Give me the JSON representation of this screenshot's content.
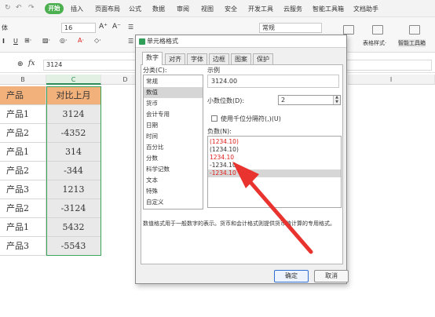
{
  "menubar": {
    "quick_access": [
      "ን",
      "↶",
      "↷"
    ],
    "start_label": "开始",
    "tabs": [
      "插入",
      "页面布局",
      "公式",
      "数据",
      "审阅",
      "视图",
      "安全",
      "开发工具",
      "云服务",
      "智能工具箱",
      "文档助手"
    ]
  },
  "ribbon": {
    "font_name": "体",
    "font_size": "16",
    "grow_font": "A⁺",
    "shrink_font": "A⁻",
    "number_format": "常规",
    "table_style_label": "表格样式·",
    "smart_toolbox_label": "智能工具箱"
  },
  "formula_bar": {
    "fx": "fx",
    "value": "3124"
  },
  "columns": {
    "B": "B",
    "C": "C",
    "D": "D",
    "I": "I"
  },
  "sheet": {
    "header": {
      "product": "产品",
      "compare": "对比上月"
    },
    "rows": [
      {
        "product": "产品1",
        "compare": "3124"
      },
      {
        "product": "产品2",
        "compare": "-4352"
      },
      {
        "product": "产品1",
        "compare": "314"
      },
      {
        "product": "产品2",
        "compare": "-344"
      },
      {
        "product": "产品3",
        "compare": "1213"
      },
      {
        "product": "产品2",
        "compare": "-3124"
      },
      {
        "product": "产品1",
        "compare": "5432"
      },
      {
        "product": "产品3",
        "compare": "-5543"
      }
    ]
  },
  "dialog": {
    "title": "单元格格式",
    "tabs": [
      "数字",
      "对齐",
      "字体",
      "边框",
      "图案",
      "保护"
    ],
    "category_label": "分类(C):",
    "categories": [
      "常规",
      "数值",
      "货币",
      "会计专用",
      "日期",
      "时间",
      "百分比",
      "分数",
      "科学记数",
      "文本",
      "特殊",
      "自定义"
    ],
    "selected_category": "数值",
    "sample_label": "示例",
    "sample_value": "3124.00",
    "decimal_label": "小数位数(D):",
    "decimal_value": "2",
    "thousands_label": "使用千位分隔符(,)(U)",
    "negative_label": "负数(N):",
    "negative_options": [
      {
        "text": "(1234.10)",
        "color": "#e0201b"
      },
      {
        "text": "(1234.10)",
        "color": "#333333"
      },
      {
        "text": "1234.10",
        "color": "#e0201b"
      },
      {
        "text": "-1234.10",
        "color": "#333333"
      },
      {
        "text": "-1234.10",
        "color": "#e0201b"
      }
    ],
    "description": "数值格式用于一般数字的表示。货币和会计格式则提供货币值计算的专用格式。",
    "ok_label": "确定",
    "cancel_label": "取消"
  },
  "colors": {
    "header_fill": "#f2b07a",
    "selection_green": "#3ba55c",
    "negative_red": "#e0201b",
    "arrow_red": "#e8332e",
    "start_green": "#4caf50"
  }
}
